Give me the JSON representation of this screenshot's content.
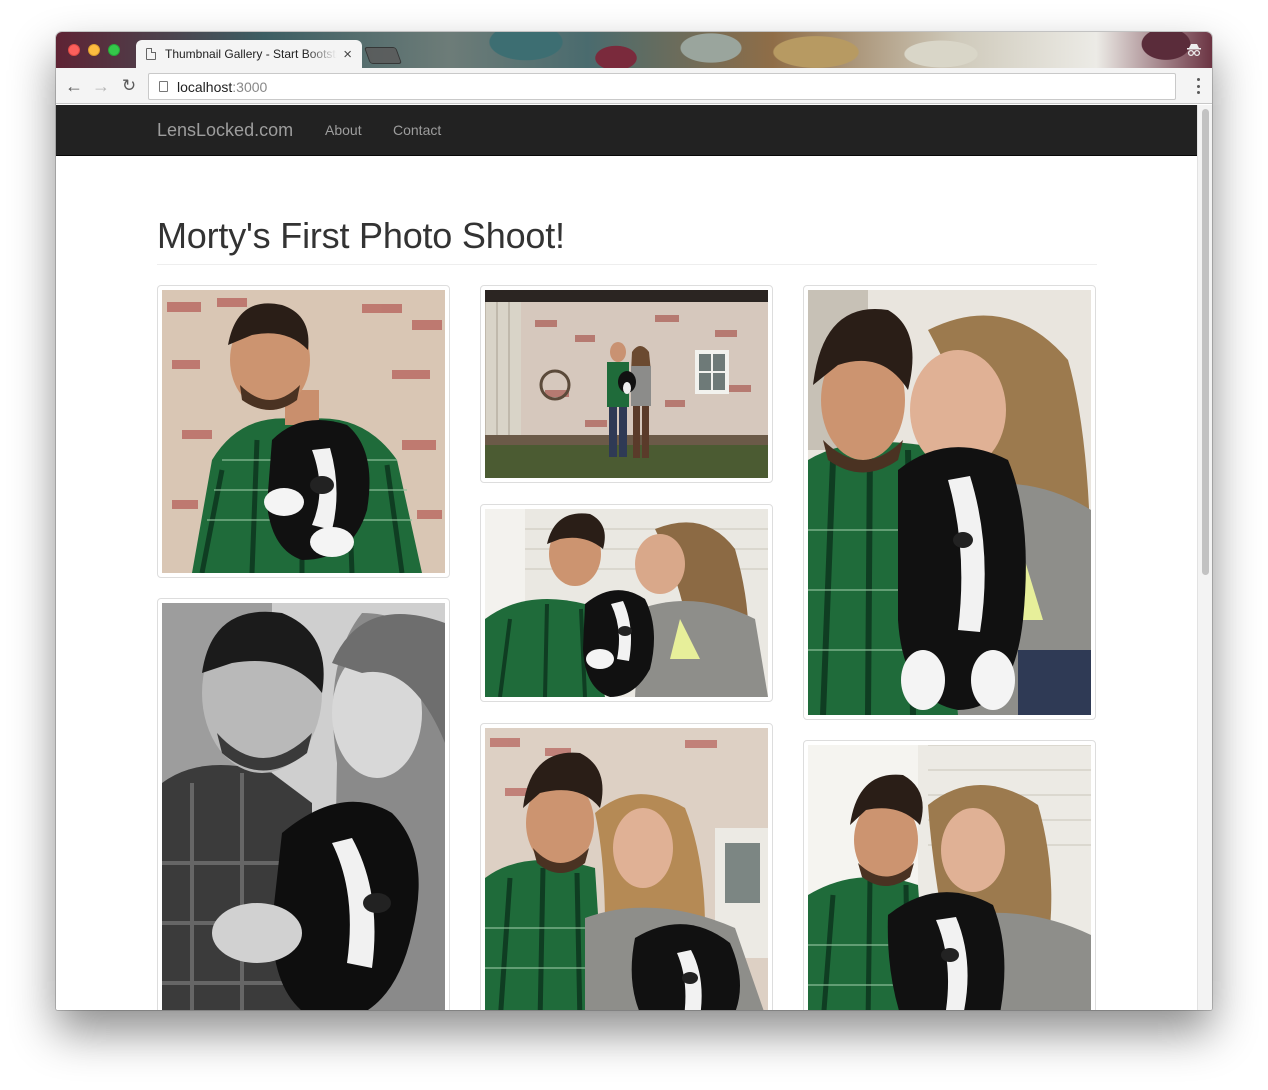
{
  "browser": {
    "tab_title": "Thumbnail Gallery - Start Bootstrap Template",
    "tab_close": "×",
    "url_host": "localhost",
    "url_port": ":3000",
    "icons": [
      "back-arrow-icon",
      "forward-arrow-icon",
      "reload-icon",
      "page-icon",
      "menu-icon",
      "incognito-icon"
    ]
  },
  "navbar": {
    "brand": "LensLocked.com",
    "links": [
      "About",
      "Contact"
    ]
  },
  "page": {
    "title": "Morty's First Photo Shoot!"
  },
  "gallery": {
    "images": [
      {
        "subject": "man-holding-puppy-brick-wall"
      },
      {
        "subject": "couple-with-puppy-in-front-of-barn"
      },
      {
        "subject": "couple-nose-to-nose-with-puppy"
      },
      {
        "subject": "couple-kissing-puppy"
      },
      {
        "subject": "black-and-white-couple-with-puppy"
      },
      {
        "subject": "couple-smiling-with-puppy-brick-wall"
      },
      {
        "subject": "couple-smiling-with-puppy-white-siding"
      }
    ]
  },
  "colors": {
    "navbar_bg": "#222222",
    "navbar_text": "#9d9d9d",
    "title_text": "#333333",
    "thumb_border": "#dddddd",
    "plaid_green": "#1f6b3a",
    "brick": "#b5605a"
  }
}
